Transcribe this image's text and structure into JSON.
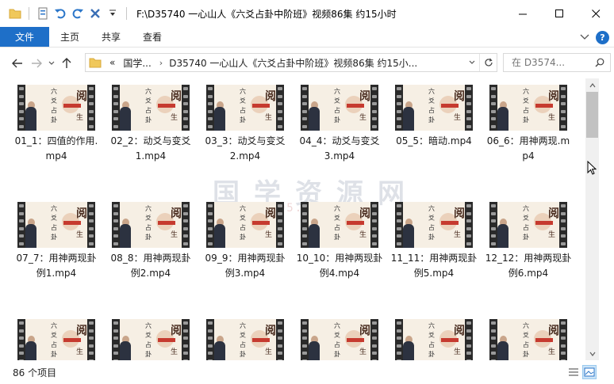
{
  "window": {
    "title": "F:\\D35740 一心山人《六爻占卦中阶班》视频86集 约15小时"
  },
  "ribbon": {
    "tabs": [
      "文件",
      "主页",
      "共享",
      "查看"
    ],
    "help": "?"
  },
  "address": {
    "prefix": "«",
    "crumbs": [
      "国学...",
      "D35740 一心山人《六爻占卦中阶班》视频86集 约15小..."
    ]
  },
  "search": {
    "placeholder": "在 D3574..."
  },
  "watermark": {
    "main": "国学资源网",
    "sub": "0595.com"
  },
  "thumbnail": {
    "vertical_text": [
      "六",
      "爻",
      "占",
      "卦"
    ],
    "brush_top": "阅",
    "brush_bottom": "生"
  },
  "files": [
    {
      "name": "01_1：四值的作用.mp4"
    },
    {
      "name": "02_2：动爻与变爻1.mp4"
    },
    {
      "name": "03_3：动爻与变爻2.mp4"
    },
    {
      "name": "04_4：动爻与变爻3.mp4"
    },
    {
      "name": "05_5：暗动.mp4"
    },
    {
      "name": "06_6：用神两现.mp4"
    },
    {
      "name": "07_7：用神两现卦例1.mp4"
    },
    {
      "name": "08_8：用神两现卦例2.mp4"
    },
    {
      "name": "09_9：用神两现卦例3.mp4"
    },
    {
      "name": "10_10：用神两现卦例4.mp4"
    },
    {
      "name": "11_11：用神两现卦例5.mp4"
    },
    {
      "name": "12_12：用神两现卦例6.mp4"
    },
    {
      "name": ""
    },
    {
      "name": ""
    },
    {
      "name": ""
    },
    {
      "name": ""
    },
    {
      "name": ""
    },
    {
      "name": ""
    }
  ],
  "status": {
    "count_text": "86 个项目"
  },
  "colors": {
    "accent": "#1e6fc8",
    "selected_view": "#cce4f7"
  }
}
